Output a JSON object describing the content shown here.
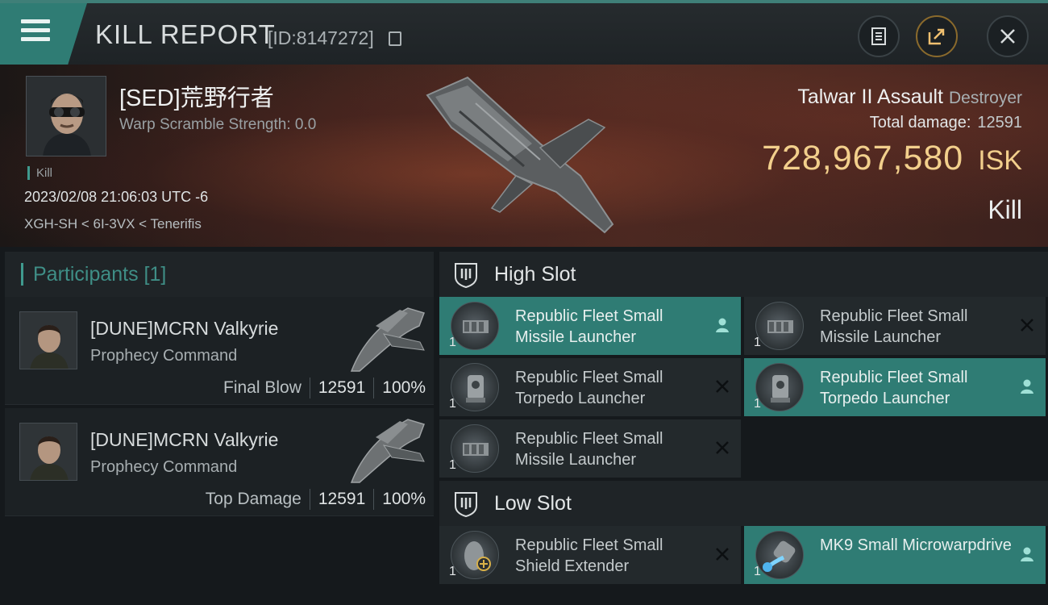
{
  "header": {
    "title": "KILL REPORT",
    "report_id": "[ID:8147272]"
  },
  "victim": {
    "name": "[SED]荒野行者",
    "warp_scramble": "Warp Scramble Strength: 0.0",
    "kill_tag": "Kill",
    "timestamp": "2023/02/08 21:06:03 UTC -6",
    "location": "XGH-SH < 6I-3VX < Tenerifis",
    "ship_name": "Talwar II Assault",
    "ship_class": "Destroyer",
    "total_damage_label": "Total damage:",
    "total_damage": "12591",
    "isk_value": "728,967,580",
    "isk_unit": "ISK",
    "result": "Kill"
  },
  "participants": {
    "title": "Participants [1]",
    "list": [
      {
        "name": "[DUNE]MCRN Valkyrie",
        "ship": "Prophecy Command",
        "role": "Final Blow",
        "damage": "12591",
        "percent": "100%"
      },
      {
        "name": "[DUNE]MCRN Valkyrie",
        "ship": "Prophecy Command",
        "role": "Top Damage",
        "damage": "12591",
        "percent": "100%"
      }
    ]
  },
  "high_slot": {
    "label": "High Slot",
    "modules": [
      {
        "name": "Republic Fleet Small Missile Launcher",
        "qty": "1",
        "status": "dropped"
      },
      {
        "name": "Republic Fleet Small Missile Launcher",
        "qty": "1",
        "status": "destroyed"
      },
      {
        "name": "Republic Fleet Small Torpedo Launcher",
        "qty": "1",
        "status": "destroyed"
      },
      {
        "name": "Republic Fleet Small Torpedo Launcher",
        "qty": "1",
        "status": "dropped"
      },
      {
        "name": "Republic Fleet Small Missile Launcher",
        "qty": "1",
        "status": "destroyed"
      }
    ]
  },
  "low_slot": {
    "label": "Low Slot",
    "modules": [
      {
        "name": "Republic Fleet Small Shield Extender",
        "qty": "1",
        "status": "destroyed"
      },
      {
        "name": "MK9 Small Microwarpdrive",
        "qty": "1",
        "status": "dropped"
      }
    ]
  },
  "icons": {
    "menu": "hamburger-icon",
    "copy": "copy-icon",
    "clipboard": "clipboard-icon",
    "share": "share-icon",
    "close": "close-icon",
    "slot": "slot-shield-icon",
    "dropped": "person-icon",
    "destroyed": "x-icon"
  },
  "colors": {
    "accent": "#2f7c74",
    "isk": "#f2cf8c",
    "panel": "#1c2124"
  }
}
